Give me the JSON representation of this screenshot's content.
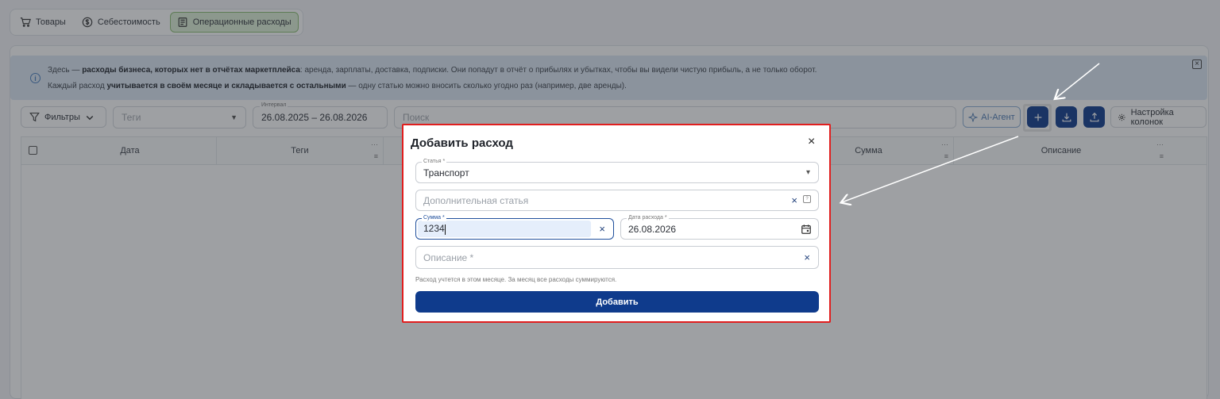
{
  "tabs": [
    {
      "label": "Товары",
      "icon": "cart-icon"
    },
    {
      "label": "Себестоимость",
      "icon": "dollar-icon"
    },
    {
      "label": "Операционные расходы",
      "icon": "receipt-icon"
    }
  ],
  "info": {
    "line1_a": "Здесь — ",
    "line1_b": "расходы бизнеса, которых нет в отчётах маркетплейса",
    "line1_c": ": аренда, зарплаты, доставка, подписки. Они попадут в отчёт о прибылях и убытках, чтобы вы видели чистую прибыль, а не только оборот.",
    "line2_a": "Каждый расход ",
    "line2_b": "учитывается в своём месяце и складывается с остальными",
    "line2_c": " — одну статью можно вносить сколько угодно раз (например, две аренды).",
    "info_glyph": "i",
    "close_glyph": "×"
  },
  "toolbar": {
    "filters_label": "Фильтры",
    "tags_placeholder": "Теги",
    "interval_label": "Интервал",
    "interval_value": "26.08.2025 – 26.08.2026",
    "search_placeholder": "Поиск",
    "ai_label": "AI-Агент",
    "columns_label": "Настройка колонок"
  },
  "table": {
    "headers": [
      "Дата",
      "Теги",
      "Сумма",
      "Описание"
    ]
  },
  "modal": {
    "title": "Добавить расход",
    "close_glyph": "×",
    "article_label": "Статья *",
    "article_value": "Транспорт",
    "extra_placeholder": "Дополнительная статья",
    "amount_label": "Сумма *",
    "amount_value": "1234",
    "date_label": "Дата расхода *",
    "date_value": "26.08.2026",
    "description_placeholder": "Описание *",
    "hint": "Расход учтется в этом месяце. За месяц все расходы суммируются.",
    "submit_label": "Добавить",
    "clear_glyph": "×",
    "dropdown_glyph": "▾"
  },
  "colors": {
    "primary": "#0f3b8c",
    "highlight_border": "#e01e1e",
    "active_tab": "#dff0d8"
  }
}
